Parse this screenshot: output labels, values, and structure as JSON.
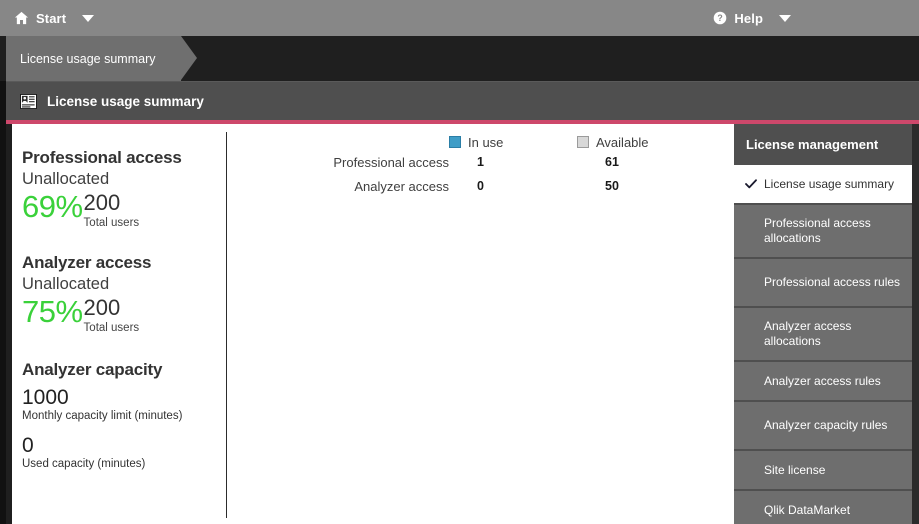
{
  "topbar": {
    "start_label": "Start",
    "start_icon": "home-icon",
    "start_caret_icon": "chevron-down-icon",
    "help_label": "Help",
    "help_icon": "help-circle-icon",
    "help_caret_icon": "chevron-down-icon"
  },
  "breadcrumb": {
    "label": "License usage summary"
  },
  "sheet": {
    "title": "License usage summary",
    "icon": "id-badge-icon",
    "accent_color": "#cd486b"
  },
  "kpis": [
    {
      "title": "Professional access",
      "subtitle": "Unallocated",
      "percent": "69%",
      "total": "200",
      "total_label": "Total users",
      "percent_color": "#3ad13a"
    },
    {
      "title": "Analyzer access",
      "subtitle": "Unallocated",
      "percent": "75%",
      "total": "200",
      "total_label": "Total users",
      "percent_color": "#3ad13a"
    }
  ],
  "capacity": {
    "title": "Analyzer capacity",
    "limit_value": "1000",
    "limit_label": "Monthly capacity limit (minutes)",
    "used_value": "0",
    "used_label": "Used capacity (minutes)"
  },
  "chart_data": {
    "type": "table",
    "title": "",
    "categories": [
      "Professional access",
      "Analyzer access"
    ],
    "series": [
      {
        "name": "In use",
        "color": "#3f9dc7",
        "values": [
          1,
          0
        ]
      },
      {
        "name": "Available",
        "color": "#d8d8d8",
        "values": [
          61,
          50
        ]
      }
    ],
    "legend": [
      "In use",
      "Available"
    ],
    "legend_position": "top",
    "xlabel": "",
    "ylabel": "",
    "grid": false,
    "rows": [
      {
        "label": "Professional access",
        "in_use": "1",
        "available": "61"
      },
      {
        "label": "Analyzer access",
        "in_use": "0",
        "available": "50"
      }
    ]
  },
  "sidebar": {
    "title": "License management",
    "items": [
      {
        "label": "License usage summary",
        "active": true,
        "check_icon": "check-icon"
      },
      {
        "label": "Professional access allocations",
        "active": false
      },
      {
        "label": "Professional access rules",
        "active": false
      },
      {
        "label": "Analyzer access allocations",
        "active": false
      },
      {
        "label": "Analyzer access rules",
        "active": false
      },
      {
        "label": "Analyzer capacity rules",
        "active": false
      },
      {
        "label": "Site license",
        "active": false
      },
      {
        "label": "Qlik DataMarket",
        "active": false
      }
    ]
  }
}
